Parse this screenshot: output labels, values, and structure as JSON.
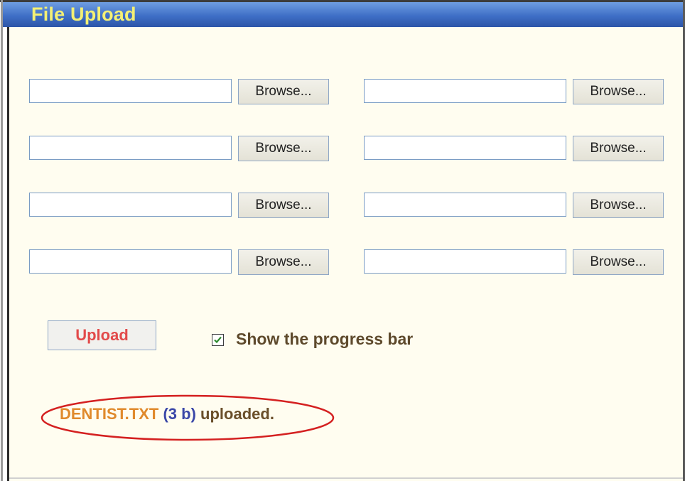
{
  "window": {
    "title": "File Upload"
  },
  "file_rows": [
    {
      "left": {
        "value": "",
        "browse_label": "Browse..."
      },
      "right": {
        "value": "",
        "browse_label": "Browse..."
      }
    },
    {
      "left": {
        "value": "",
        "browse_label": "Browse..."
      },
      "right": {
        "value": "",
        "browse_label": "Browse..."
      }
    },
    {
      "left": {
        "value": "",
        "browse_label": "Browse..."
      },
      "right": {
        "value": "",
        "browse_label": "Browse..."
      }
    },
    {
      "left": {
        "value": "",
        "browse_label": "Browse..."
      },
      "right": {
        "value": "",
        "browse_label": "Browse..."
      }
    }
  ],
  "upload_button": {
    "label": "Upload"
  },
  "progress_option": {
    "label": "Show the progress bar",
    "checked": true
  },
  "status": {
    "filename": "DENTIST.TXT",
    "size": "(3 b)",
    "message": "uploaded."
  },
  "colors": {
    "title_bar": "#3f6fc6",
    "title_text": "#f4f074",
    "panel_background": "#fffdf0",
    "upload_label": "#e24a4a",
    "filename": "#e08a2c",
    "size": "#3a47a8",
    "message": "#6a4f2a",
    "highlight_ellipse": "#d42020"
  }
}
